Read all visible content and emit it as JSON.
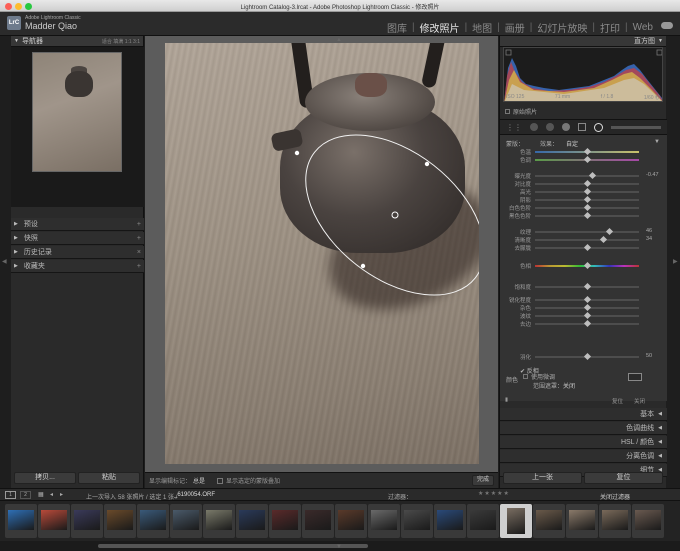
{
  "window": {
    "title": "Lightroom Catalog-3.lrcat - Adobe Photoshop Lightroom Classic - 修改照片"
  },
  "identity": {
    "product": "Adobe Lightroom Classic",
    "user": "Madder Qiao",
    "logo_text": "LrC"
  },
  "modules": [
    "图库",
    "修改照片",
    "地图",
    "画册",
    "幻灯片放映",
    "打印",
    "Web"
  ],
  "active_module": "修改照片",
  "left_panel": {
    "navigator": {
      "title": "导航器",
      "options": "适合  填满  1:1  3:1"
    },
    "sections": [
      {
        "label": "预设",
        "action": "+"
      },
      {
        "label": "快照",
        "action": "+"
      },
      {
        "label": "历史记录",
        "action": "×"
      },
      {
        "label": "收藏夹",
        "action": "+"
      }
    ],
    "copy_button": "拷贝...",
    "paste_button": "粘贴"
  },
  "toolbar": {
    "show_pins": "显示编辑标记：",
    "show_pins_value": "总是",
    "show_mask_overlay": "显示选定的蒙版叠加",
    "done_button": "完成"
  },
  "right_panel": {
    "histogram_title": "直方图",
    "histogram_info": {
      "iso": "ISO 125",
      "focal": "71 mm",
      "aperture": "f / 1.8",
      "shutter": "1/60 秒"
    },
    "original_photo": "原始照片",
    "mask": {
      "label": "蒙版：",
      "value": "新建",
      "effect_label": "效果：",
      "effect_value": "自定"
    },
    "sliders": [
      {
        "label": "色温",
        "pos": 0.5,
        "num": "",
        "kind": "temp"
      },
      {
        "label": "色调",
        "pos": 0.5,
        "num": "",
        "kind": "tint"
      },
      {
        "label": "曝光度",
        "pos": 0.55,
        "num": "-0.47",
        "kind": ""
      },
      {
        "label": "对比度",
        "pos": 0.5,
        "num": "",
        "kind": ""
      },
      {
        "label": "高光",
        "pos": 0.5,
        "num": "",
        "kind": ""
      },
      {
        "label": "阴影",
        "pos": 0.5,
        "num": "",
        "kind": ""
      },
      {
        "label": "白色色阶",
        "pos": 0.5,
        "num": "",
        "kind": ""
      },
      {
        "label": "黑色色阶",
        "pos": 0.5,
        "num": "",
        "kind": ""
      },
      {
        "label": "纹理",
        "pos": 0.72,
        "num": "46",
        "kind": ""
      },
      {
        "label": "清晰度",
        "pos": 0.66,
        "num": "34",
        "kind": ""
      },
      {
        "label": "去朦胧",
        "pos": 0.5,
        "num": "",
        "kind": ""
      },
      {
        "label": "色相",
        "pos": 0.5,
        "num": "",
        "kind": "color"
      },
      {
        "label": "饱和度",
        "pos": 0.5,
        "num": "",
        "kind": ""
      },
      {
        "label": "锐化程度",
        "pos": 0.5,
        "num": "",
        "kind": ""
      },
      {
        "label": "杂色",
        "pos": 0.5,
        "num": "",
        "kind": ""
      },
      {
        "label": "波纹",
        "pos": 0.5,
        "num": "",
        "kind": ""
      },
      {
        "label": "去边",
        "pos": 0.5,
        "num": "",
        "kind": ""
      }
    ],
    "fine_adjust": "使用微调",
    "color_label": "颜色",
    "feather": {
      "label": "羽化",
      "pos": 0.5,
      "num": "50"
    },
    "invert": "反相",
    "range_mask": "范围遮罩：",
    "range_mask_value": "关闭",
    "reset": "复位",
    "close": "关闭",
    "sections": [
      "基本",
      "色调曲线",
      "HSL / 颜色",
      "分离色调",
      "细节"
    ],
    "prev_button": "上一张",
    "reset_button": "复位"
  },
  "filmstrip": {
    "pages": [
      "1",
      "2"
    ],
    "source": "上一次导入",
    "count": "58 张照片 / 选定 1 张 /",
    "filename": "_6190054.ORF",
    "filter_label": "过滤器：",
    "filter_value": "关闭过滤器"
  },
  "colors": {
    "accent": "#e6e6e6",
    "panel": "#2a2a2a",
    "center_bg": "#5c5c5c"
  }
}
